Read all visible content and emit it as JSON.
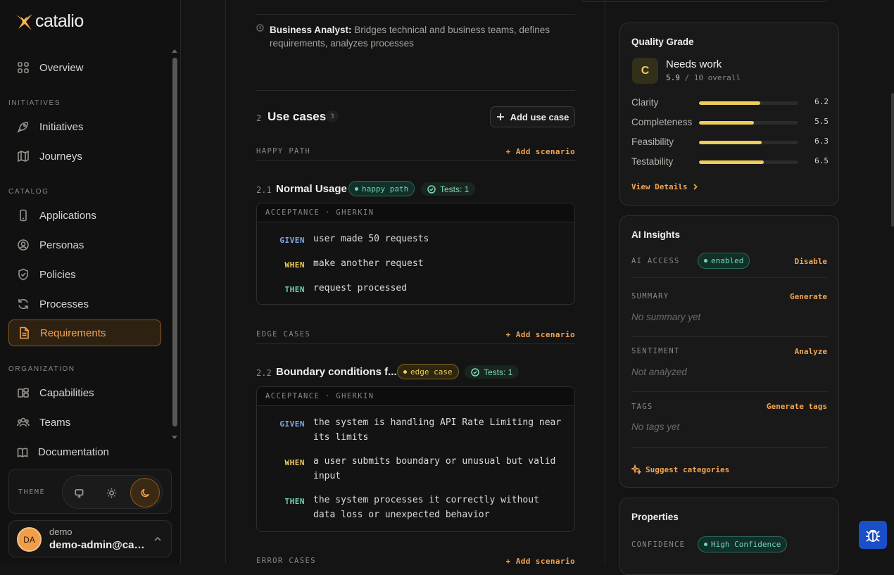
{
  "brand": {
    "name": "catalio"
  },
  "sidebar": {
    "overview": "Overview",
    "sections": {
      "initiatives": "INITIATIVES",
      "catalog": "CATALOG",
      "organization": "ORGANIZATION"
    },
    "items": {
      "initiatives": "Initiatives",
      "journeys": "Journeys",
      "applications": "Applications",
      "personas": "Personas",
      "policies": "Policies",
      "processes": "Processes",
      "requirements": "Requirements",
      "capabilities": "Capabilities",
      "teams": "Teams"
    },
    "documentation": "Documentation",
    "theme_label": "THEME",
    "user": {
      "initials": "DA",
      "name": "demo",
      "email": "demo-admin@catalio"
    }
  },
  "main": {
    "persona_note": {
      "role": "Business Analyst:",
      "text": " Bridges technical and business teams, defines requirements, analyzes processes"
    },
    "use_cases": {
      "number": "2",
      "title": "Use cases",
      "count": "3",
      "add_label": "Add use case"
    },
    "happy_path": {
      "label": "HAPPY PATH",
      "add": "+ Add scenario",
      "scenario": {
        "number": "2.1",
        "title": "Normal Usage",
        "badge": "happy path",
        "tests": "Tests: 1",
        "header": "ACCEPTANCE · GHERKIN",
        "given_kw": "GIVEN",
        "given": "user made 50 requests",
        "when_kw": "WHEN",
        "when": "make another request",
        "then_kw": "THEN",
        "then": "request processed"
      }
    },
    "edge_cases": {
      "label": "EDGE CASES",
      "add": "+ Add scenario",
      "scenario": {
        "number": "2.2",
        "title": "Boundary conditions f...",
        "badge": "edge case",
        "tests": "Tests: 1",
        "header": "ACCEPTANCE · GHERKIN",
        "given_kw": "GIVEN",
        "given": "the system is handling API Rate Limiting near its limits",
        "when_kw": "WHEN",
        "when": "a user submits boundary or unusual but valid input",
        "then_kw": "THEN",
        "then": "the system processes it correctly without data loss or unexpected behavior"
      }
    },
    "error_cases": {
      "label": "ERROR CASES",
      "add": "+ Add scenario"
    }
  },
  "quality": {
    "title": "Quality Grade",
    "grade": "C",
    "status": "Needs work",
    "score": "5.9",
    "score_suffix": " / 10 overall",
    "metrics": [
      {
        "label": "Clarity",
        "value": "6.2",
        "fraction": 0.62
      },
      {
        "label": "Completeness",
        "value": "5.5",
        "fraction": 0.55
      },
      {
        "label": "Feasibility",
        "value": "6.3",
        "fraction": 0.63
      },
      {
        "label": "Testability",
        "value": "6.5",
        "fraction": 0.65
      }
    ],
    "view_details": "View Details"
  },
  "ai": {
    "title": "AI Insights",
    "access_label": "AI ACCESS",
    "access_badge": "enabled",
    "access_action": "Disable",
    "summary_label": "SUMMARY",
    "summary_action": "Generate",
    "summary_empty": "No summary yet",
    "sentiment_label": "SENTIMENT",
    "sentiment_action": "Analyze",
    "sentiment_empty": "Not analyzed",
    "tags_label": "TAGS",
    "tags_action": "Generate tags",
    "tags_empty": "No tags yet",
    "suggest": "Suggest categories"
  },
  "properties": {
    "title": "Properties",
    "confidence_label": "CONFIDENCE",
    "confidence_value": "High Confidence"
  },
  "colors": {
    "accent": "#f3a451",
    "success": "#6fd6b5",
    "warning": "#f0cd58",
    "info": "#7ea7e8"
  }
}
